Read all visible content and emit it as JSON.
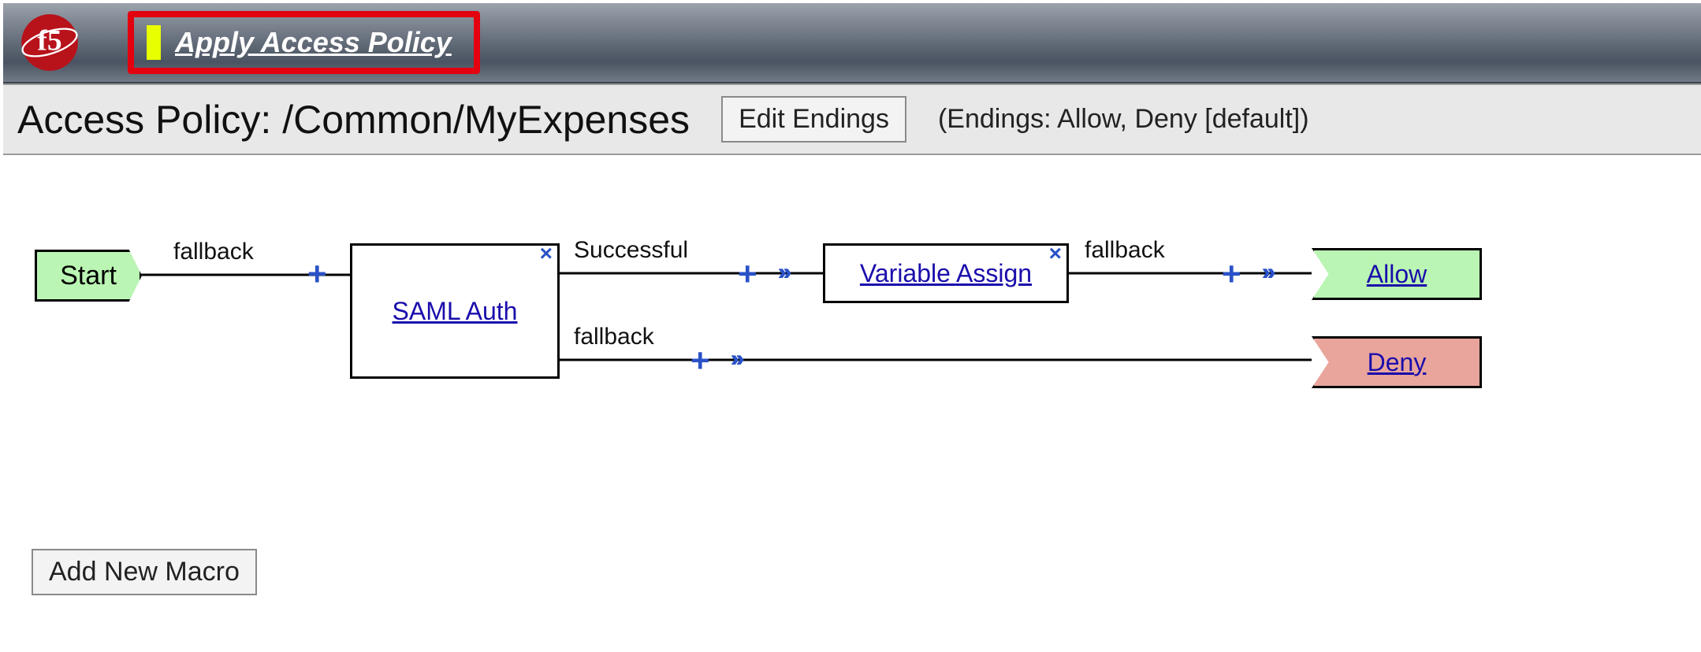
{
  "banner": {
    "apply_label": "Apply Access Policy"
  },
  "header": {
    "title": "Access Policy: /Common/MyExpenses",
    "edit_endings_label": "Edit Endings",
    "endings_note": "(Endings: Allow, Deny [default])"
  },
  "nodes": {
    "start": "Start",
    "saml_auth": "SAML Auth",
    "variable_assign": "Variable Assign",
    "allow": "Allow",
    "deny": "Deny"
  },
  "edges": {
    "start_fallback": "fallback",
    "saml_success": "Successful",
    "saml_fallback": "fallback",
    "var_fallback": "fallback"
  },
  "footer": {
    "add_macro_label": "Add New Macro"
  },
  "glyphs": {
    "close": "×",
    "plus": "+"
  }
}
